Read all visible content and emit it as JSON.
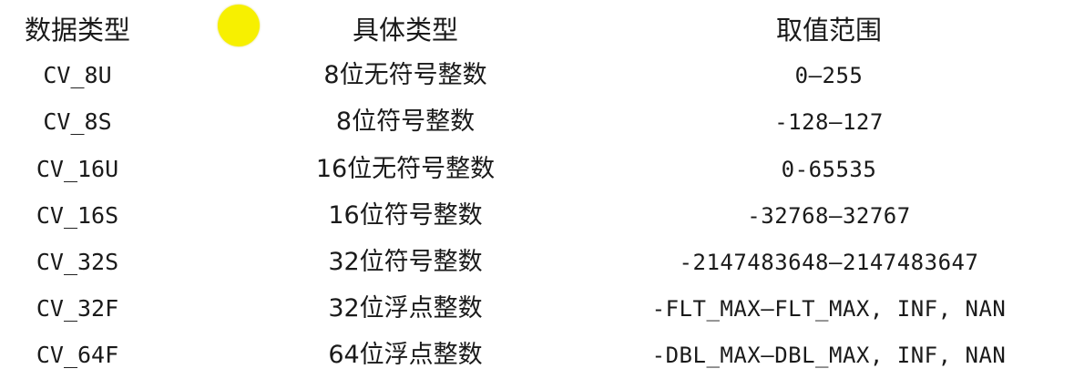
{
  "headers": {
    "data_type": "数据类型",
    "specific_type": "具体类型",
    "value_range": "取值范围"
  },
  "rows": [
    {
      "data_type": "CV_8U",
      "specific_type": "8位无符号整数",
      "value_range": "0—255"
    },
    {
      "data_type": "CV_8S",
      "specific_type": "8位符号整数",
      "value_range": "-128—127"
    },
    {
      "data_type": "CV_16U",
      "specific_type": "16位无符号整数",
      "value_range": "0-65535"
    },
    {
      "data_type": "CV_16S",
      "specific_type": "16位符号整数",
      "value_range": "-32768—32767"
    },
    {
      "data_type": "CV_32S",
      "specific_type": "32位符号整数",
      "value_range": "-2147483648—2147483647"
    },
    {
      "data_type": "CV_32F",
      "specific_type": "32位浮点整数",
      "value_range": "-FLT_MAX—FLT_MAX, INF, NAN"
    },
    {
      "data_type": "CV_64F",
      "specific_type": "64位浮点整数",
      "value_range": "-DBL_MAX—DBL_MAX, INF, NAN"
    }
  ],
  "colors": {
    "background": "#ffffff",
    "text": "#1a1a1a",
    "cursor_highlight": "#f7f000"
  }
}
